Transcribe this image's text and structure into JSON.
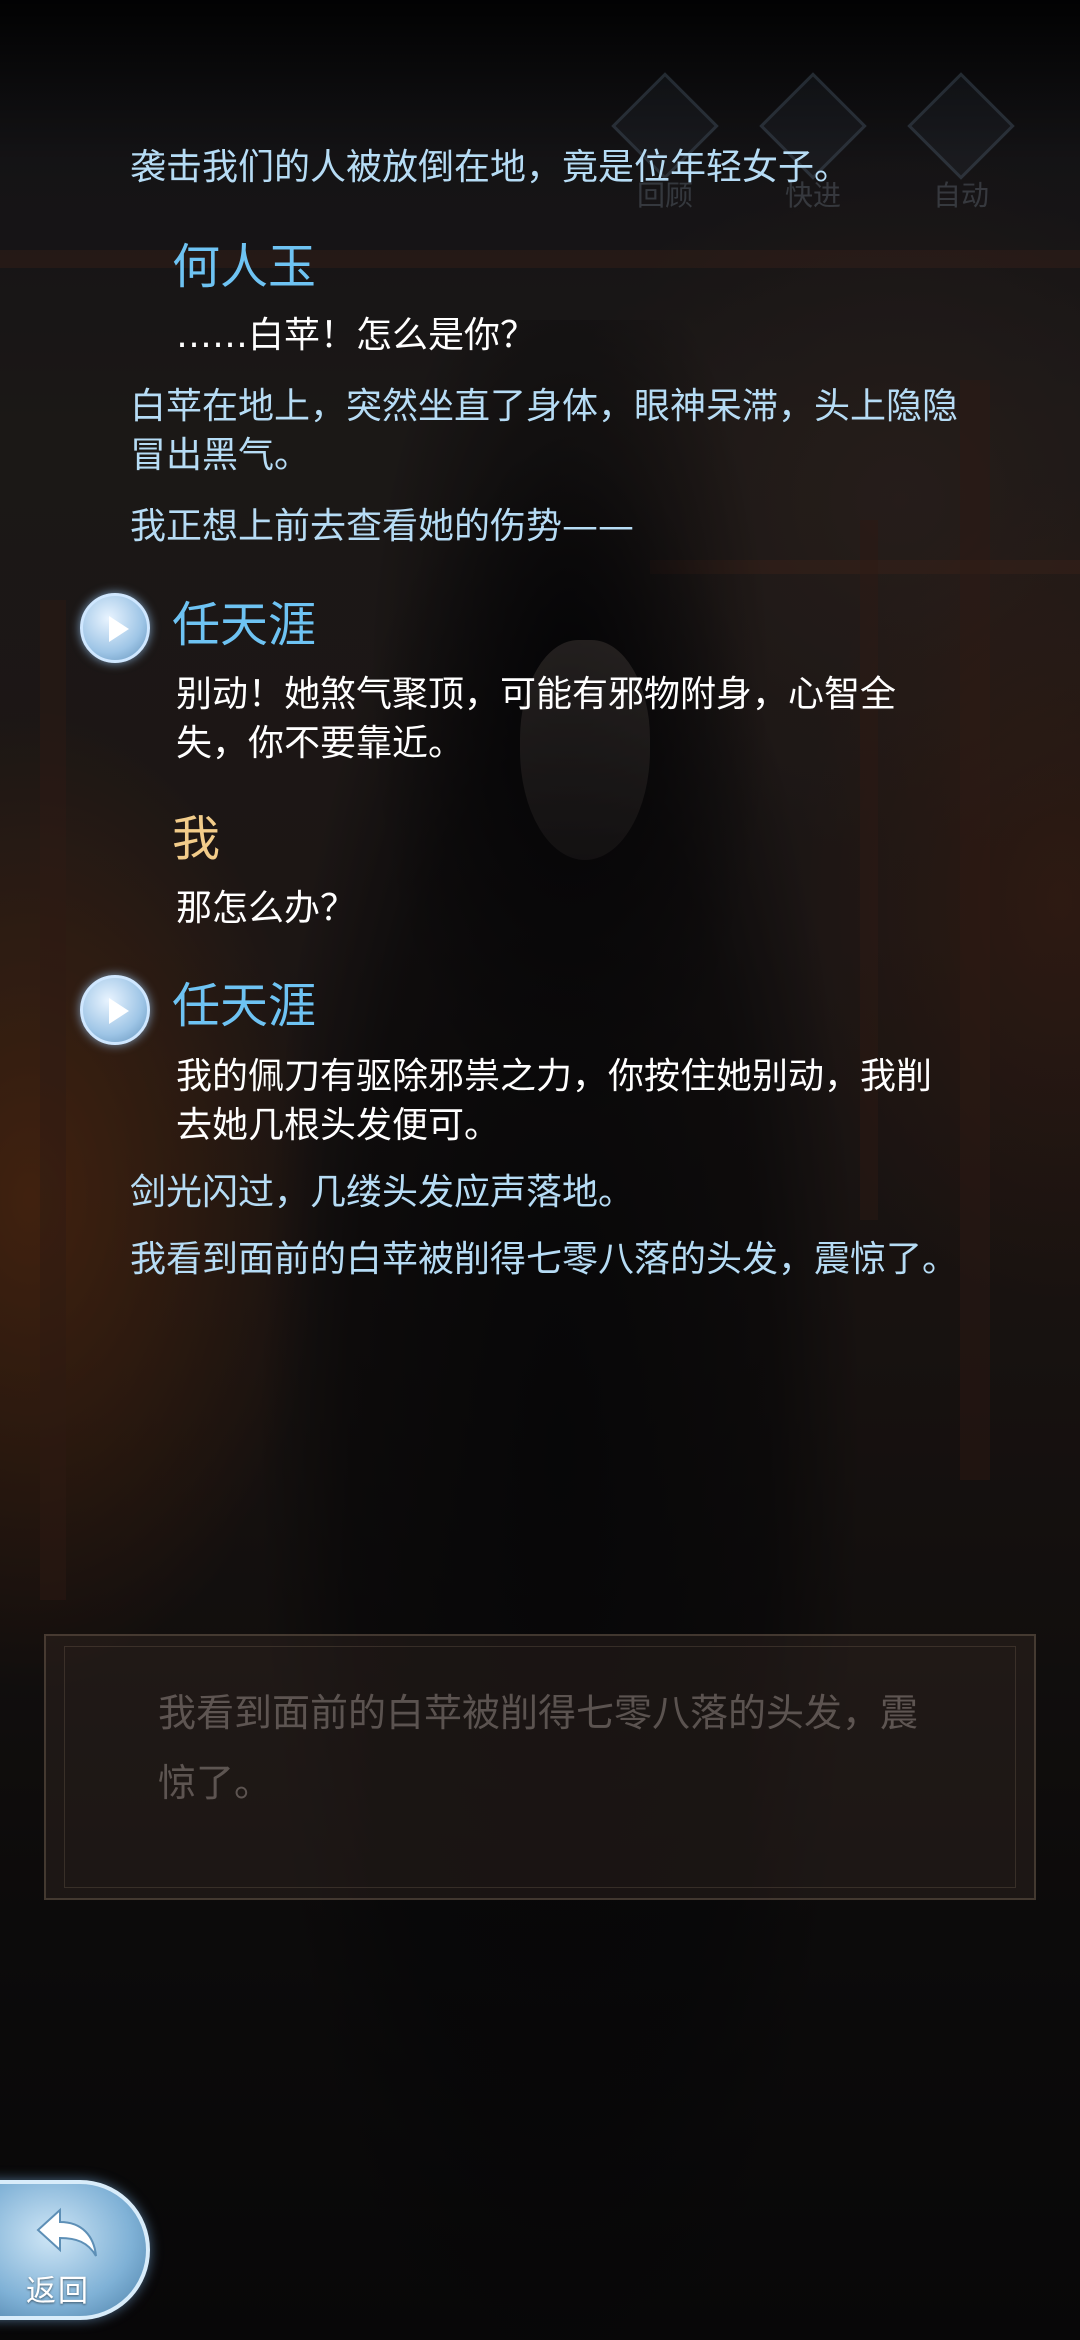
{
  "top_controls": [
    {
      "label": "回顾",
      "icon": "review-icon"
    },
    {
      "label": "快进",
      "icon": "fast-forward-icon"
    },
    {
      "label": "自动",
      "icon": "auto-play-icon"
    }
  ],
  "log": {
    "entries": [
      {
        "type": "narration",
        "text": "袭击我们的人被放倒在地，竟是位年轻女子。"
      },
      {
        "type": "speech",
        "speaker": "何人玉",
        "text": "……白苹！怎么是你？",
        "voice": false
      },
      {
        "type": "narration",
        "text": "白苹在地上，突然坐直了身体，眼神呆滞，头上隐隐冒出黑气。"
      },
      {
        "type": "narration",
        "text": "我正想上前去查看她的伤势——"
      },
      {
        "type": "speech",
        "speaker": "任天涯",
        "text": "别动！她煞气聚顶，可能有邪物附身，心智全失，你不要靠近。",
        "voice": true
      },
      {
        "type": "speech",
        "speaker": "我",
        "text": "那怎么办？",
        "voice": false
      },
      {
        "type": "speech",
        "speaker": "任天涯",
        "text": "我的佩刀有驱除邪祟之力，你按住她别动，我削去她几根头发便可。",
        "voice": true
      },
      {
        "type": "narration",
        "text": "剑光闪过，几缕头发应声落地。"
      },
      {
        "type": "narration",
        "text": "我看到面前的白苹被削得七零八落的头发，震惊了。"
      }
    ]
  },
  "dialog_box": {
    "text": "我看到面前的白苹被削得七零八落的头发，震惊了。"
  },
  "back_button": {
    "label": "返回",
    "icon": "back-arrow-icon"
  },
  "colors": {
    "narration": "#b6dcf5",
    "speaker": "#6ec3f3",
    "player_speaker": "#f2cc8a",
    "dialog": "#ffffff"
  }
}
